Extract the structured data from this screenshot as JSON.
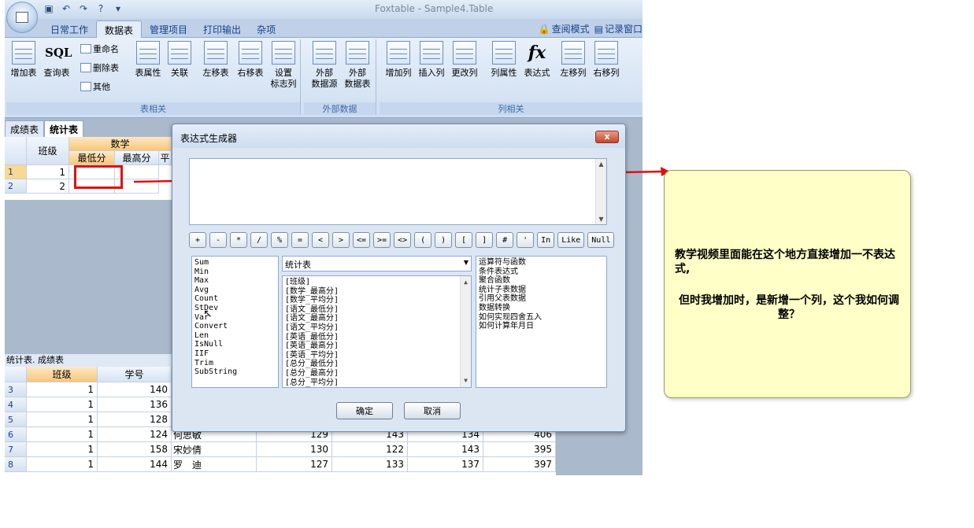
{
  "app": {
    "window_title": "Foxtable - Sample4.Table",
    "tabs": [
      "日常工作",
      "数据表",
      "管理项目",
      "打印输出",
      "杂项"
    ],
    "right_buttons": [
      "查阅模式",
      "记录窗口"
    ]
  },
  "ribbon": {
    "group1": {
      "label": "表相关",
      "buttons": [
        "增加表",
        "查询表",
        "表属性",
        "关联",
        "左移表",
        "右移表"
      ],
      "setup_button": [
        "设置",
        "标志列"
      ],
      "small_buttons": [
        "重命名",
        "删除表",
        "其他"
      ],
      "sql_icon": "SQL"
    },
    "group2": {
      "label": "外部数据",
      "buttons": [
        [
          "外部",
          "数据源"
        ],
        [
          "外部",
          "数据表"
        ]
      ]
    },
    "group3": {
      "label": "列相关",
      "buttons": [
        "增加列",
        "插入列",
        "更改列",
        "列属性",
        "表达式",
        "左移列",
        "右移列"
      ],
      "fx_icon": "fx"
    }
  },
  "sheet_tabs": [
    "成绩表",
    "统计表"
  ],
  "grid1": {
    "col_class": "班级",
    "col_math": "数学",
    "sub_cols": [
      "最低分",
      "最高分",
      "平"
    ],
    "rows": [
      {
        "no": "1",
        "class": "1"
      },
      {
        "no": "2",
        "class": "2"
      }
    ]
  },
  "grid2": {
    "title": "统计表. 成绩表",
    "headers": [
      "班级",
      "学号"
    ],
    "rows": [
      {
        "no": "3",
        "class": "1",
        "id": "140",
        "name": "",
        "a": "",
        "b": "",
        "c": "",
        "total": ""
      },
      {
        "no": "4",
        "class": "1",
        "id": "136",
        "name": "",
        "a": "",
        "b": "",
        "c": "",
        "total": ""
      },
      {
        "no": "5",
        "class": "1",
        "id": "128",
        "name": "",
        "a": "",
        "b": "",
        "c": "",
        "total": ""
      },
      {
        "no": "6",
        "class": "1",
        "id": "124",
        "name": "何思敏",
        "a": "129",
        "b": "143",
        "c": "134",
        "total": "406"
      },
      {
        "no": "7",
        "class": "1",
        "id": "158",
        "name": "宋妙倩",
        "a": "130",
        "b": "122",
        "c": "143",
        "total": "395"
      },
      {
        "no": "8",
        "class": "1",
        "id": "144",
        "name": "罗　迪",
        "a": "127",
        "b": "133",
        "c": "137",
        "total": "397"
      }
    ]
  },
  "dialog": {
    "title": "表达式生成器",
    "close": "x",
    "operators": [
      "+",
      "-",
      "*",
      "/",
      "%",
      "=",
      "<",
      ">",
      "<=",
      ">=",
      "<>",
      "(",
      ")",
      "[",
      "]",
      "#",
      "'",
      "In",
      "Like",
      "Null"
    ],
    "functions": [
      "Sum",
      "Min",
      "Max",
      "Avg",
      "Count",
      "StDev",
      "Var",
      "Convert",
      "Len",
      "IsNull",
      "IIF",
      "Trim",
      "SubString"
    ],
    "table_select": "统计表",
    "fields": [
      "[班级]",
      "[数学_最高分]",
      "[数学_平均分]",
      "[语文_最低分]",
      "[语文_最高分]",
      "[语文_平均分]",
      "[英语_最低分]",
      "[英语_最高分]",
      "[英语_平均分]",
      "[总分_最低分]",
      "[总分_最高分]",
      "[总分_平均分]"
    ],
    "help_topics": [
      "运算符与函数",
      "条件表达式",
      "聚合函数",
      "统计子表数据",
      "引用父表数据",
      "数据转换",
      "如何实现四舍五入",
      "如何计算年月日"
    ],
    "ok": "确定",
    "cancel": "取消"
  },
  "callout": {
    "line1": "教学视频里面能在这个地方直接增加一不表达式,",
    "line2": "但时我增加时，是新增一个列，这个我如何调整？"
  },
  "colors": {
    "annotation_red": "#e01010",
    "callout_bg": "#ffffc8"
  }
}
